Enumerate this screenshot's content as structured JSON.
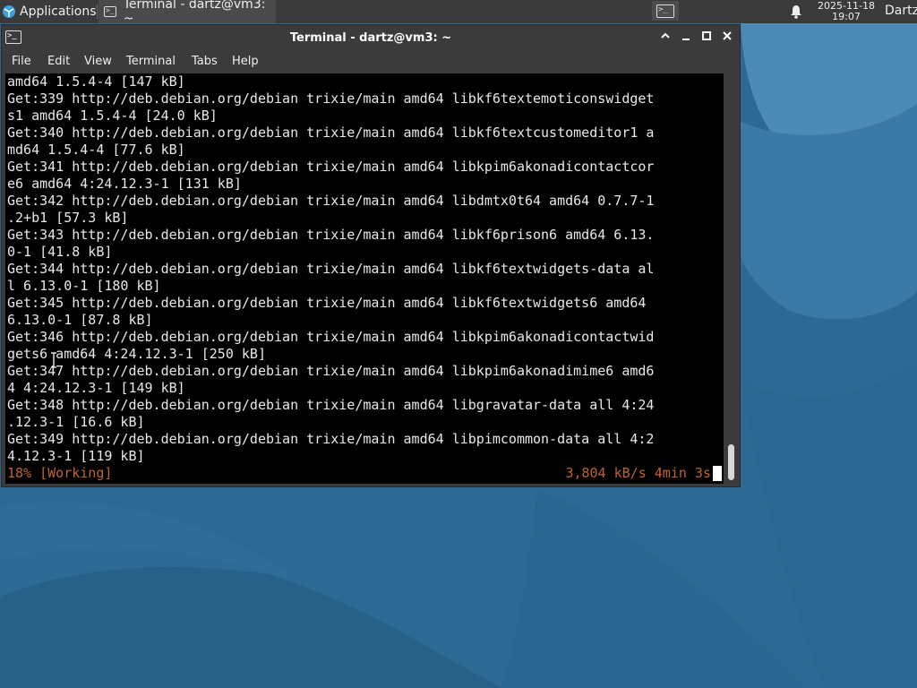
{
  "panel": {
    "applications_label": "Applications",
    "task_label": "Terminal - dartz@vm3: ~",
    "date": "2025-11-18",
    "time": "19:07",
    "user": "Dartz",
    "icons": {
      "apps": "applications-menu-icon",
      "task": "terminal-icon",
      "notify": "bell-icon",
      "launcher": "terminal-launcher-icon"
    }
  },
  "window": {
    "title": "Terminal - dartz@vm3: ~",
    "controls": {
      "maximize_up": "^",
      "minimize": "–",
      "maximize": "□",
      "close": "×"
    },
    "menu": [
      "File",
      "Edit",
      "View",
      "Terminal",
      "Tabs",
      "Help"
    ]
  },
  "terminal": {
    "lines": [
      "amd64 1.5.4-4 [147 kB]",
      "Get:339 http://deb.debian.org/debian trixie/main amd64 libkf6textemoticonswidget",
      "s1 amd64 1.5.4-4 [24.0 kB]",
      "Get:340 http://deb.debian.org/debian trixie/main amd64 libkf6textcustomeditor1 a",
      "md64 1.5.4-4 [77.6 kB]",
      "Get:341 http://deb.debian.org/debian trixie/main amd64 libkpim6akonadicontactcor",
      "e6 amd64 4:24.12.3-1 [131 kB]",
      "Get:342 http://deb.debian.org/debian trixie/main amd64 libdmtx0t64 amd64 0.7.7-1",
      ".2+b1 [57.3 kB]",
      "Get:343 http://deb.debian.org/debian trixie/main amd64 libkf6prison6 amd64 6.13.",
      "0-1 [41.8 kB]",
      "Get:344 http://deb.debian.org/debian trixie/main amd64 libkf6textwidgets-data al",
      "l 6.13.0-1 [180 kB]",
      "Get:345 http://deb.debian.org/debian trixie/main amd64 libkf6textwidgets6 amd64",
      "6.13.0-1 [87.8 kB]",
      "Get:346 http://deb.debian.org/debian trixie/main amd64 libkpim6akonadicontactwid",
      "gets6 amd64 4:24.12.3-1 [250 kB]",
      "Get:347 http://deb.debian.org/debian trixie/main amd64 libkpim6akonadimime6 amd6",
      "4 4:24.12.3-1 [149 kB]",
      "Get:348 http://deb.debian.org/debian trixie/main amd64 libgravatar-data all 4:24",
      ".12.3-1 [16.6 kB]",
      "Get:349 http://deb.debian.org/debian trixie/main amd64 libpimcommon-data all 4:2",
      "4.12.3-1 [119 kB]"
    ],
    "status_left": "18% [Working]",
    "status_right": "3,804 kB/s 4min 3s",
    "status_color": "#c0632d"
  },
  "colors": {
    "desktop": "#2e6c95",
    "panel": "#3a3a3a",
    "window": "#3b3b3b",
    "terminal_bg": "#000000",
    "terminal_fg": "#e8e8e8"
  }
}
